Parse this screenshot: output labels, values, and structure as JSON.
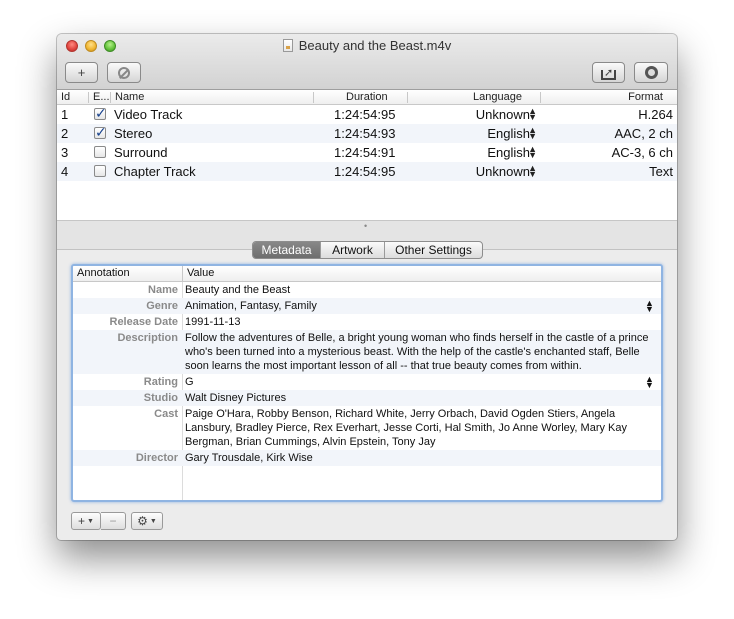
{
  "window": {
    "title": "Beauty and the Beast.m4v"
  },
  "toolbar": {
    "add_icon": "plus-icon",
    "remove_icon": "ban-icon",
    "share_icon": "share-icon",
    "inspector_icon": "circle-icon"
  },
  "tracks": {
    "headers": {
      "id": "Id",
      "enabled": "E...",
      "name": "Name",
      "duration": "Duration",
      "language": "Language",
      "format": "Format"
    },
    "rows": [
      {
        "id": "1",
        "enabled": true,
        "name": "Video Track",
        "duration": "1:24:54:95",
        "language": "Unknown",
        "format": "H.264"
      },
      {
        "id": "2",
        "enabled": true,
        "name": "Stereo",
        "duration": "1:24:54:93",
        "language": "English",
        "format": "AAC, 2 ch"
      },
      {
        "id": "3",
        "enabled": false,
        "name": "Surround",
        "duration": "1:24:54:91",
        "language": "English",
        "format": "AC-3, 6 ch"
      },
      {
        "id": "4",
        "enabled": false,
        "name": "Chapter Track",
        "duration": "1:24:54:95",
        "language": "Unknown",
        "format": "Text"
      }
    ]
  },
  "tabs": {
    "metadata": "Metadata",
    "artwork": "Artwork",
    "other": "Other Settings",
    "active": "metadata"
  },
  "metadata": {
    "headers": {
      "annotation": "Annotation",
      "value": "Value"
    },
    "rows": [
      {
        "label": "Name",
        "value": "Beauty and the Beast"
      },
      {
        "label": "Genre",
        "value": "Animation, Fantasy, Family"
      },
      {
        "label": "Release Date",
        "value": "1991-11-13"
      },
      {
        "label": "Description",
        "value": "Follow the adventures of Belle, a bright young woman who finds herself in the castle of a prince who's been turned into a mysterious beast. With the help of the castle's enchanted staff, Belle soon learns the most important lesson of all -- that true beauty comes from within."
      },
      {
        "label": "Rating",
        "value": "G"
      },
      {
        "label": "Studio",
        "value": "Walt Disney Pictures"
      },
      {
        "label": "Cast",
        "value": "Paige O'Hara, Robby Benson, Richard White, Jerry Orbach, David Ogden Stiers, Angela Lansbury, Bradley Pierce, Rex Everhart, Jesse Corti, Hal Smith, Jo Anne Worley, Mary Kay Bergman, Brian Cummings, Alvin Epstein, Tony Jay"
      },
      {
        "label": "Director",
        "value": "Gary Trousdale, Kirk Wise"
      }
    ]
  },
  "bottom": {
    "add_label": "+",
    "remove_label": "−",
    "gear_icon": "gear-icon"
  }
}
